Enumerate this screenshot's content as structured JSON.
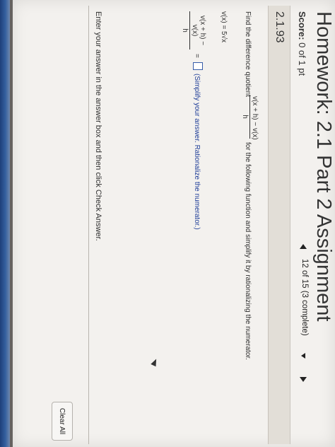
{
  "assignment": {
    "title": "Homework: 2.1 Part 2 Assignment",
    "score_label": "Score:",
    "score_value": "0 of 1 pt"
  },
  "question": {
    "number": "2.1.93",
    "progress": "12 of 15 (3 complete)",
    "prompt_prefix": "Find the difference quotient",
    "prompt_fraction_numerator": "v(x + h) − v(x)",
    "prompt_fraction_denominator": "h",
    "prompt_suffix": "for the following function and simplify it by rationalizing the numerator.",
    "function": "v(x) = 5√x",
    "answer_fraction_numerator": "v(x + h) − v(x)",
    "answer_fraction_denominator": "h",
    "equals": "=",
    "answer_value": "",
    "answer_hint": "(Simplify your answer. Rationalize the numerator.)"
  },
  "footer": {
    "instruction": "Enter your answer in the answer box and then click Check Answer.",
    "clear_all": "Clear All"
  },
  "icons": {
    "previous": "triangle-left-icon",
    "dropdown": "chevron-down-icon",
    "next": "triangle-right-icon",
    "pointer": "mouse-pointer-icon"
  }
}
